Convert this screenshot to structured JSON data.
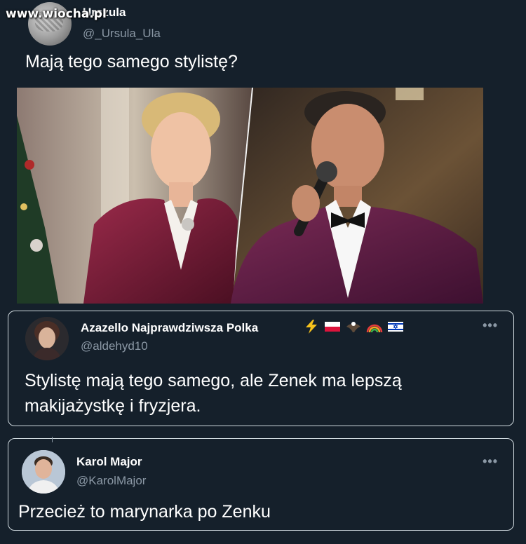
{
  "watermark": "www.wiocha.pl",
  "main_tweet": {
    "author_name": "Urszula",
    "author_handle": "@_Ursula_Ula",
    "text": "Mają tego samego stylistę?"
  },
  "quotes": [
    {
      "author_name": "Azazello Najprawdziwsza Polka",
      "author_handle": "@aldehyd10",
      "text": "Stylistę mają tego samego, ale Zenek ma lepszą makijażystkę i fryzjera.",
      "badges": [
        "lightning-icon",
        "poland-flag-icon",
        "eagle-icon",
        "rainbow-icon",
        "israel-flag-icon"
      ]
    },
    {
      "author_name": "Karol Major",
      "author_handle": "@KarolMajor",
      "text": "Przecież to marynarka po Zenku"
    }
  ],
  "colors": {
    "background": "#15202b",
    "secondary_text": "#8b98a5",
    "border": "#cfd9de",
    "velvet": "#7a1f3d"
  }
}
